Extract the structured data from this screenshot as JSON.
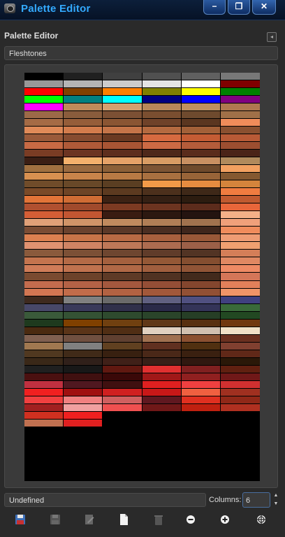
{
  "window": {
    "title": "Palette Editor",
    "minimize_glyph": "−",
    "restore_glyph": "❐",
    "close_glyph": "✕"
  },
  "panel": {
    "title": "Palette Editor",
    "collapse_glyph": "◂"
  },
  "palette_selector": {
    "value": "Fleshtones"
  },
  "swatches": [
    "#000000",
    "#202020",
    "#404040",
    "#505050",
    "#606060",
    "#787878",
    "#989898",
    "#b4b4b4",
    "#cccccc",
    "#e4e4e4",
    "#ffffff",
    "#800000",
    "#ff0000",
    "#804000",
    "#ff8000",
    "#808000",
    "#ffff00",
    "#008000",
    "#00ff00",
    "#008080",
    "#00ffff",
    "#000080",
    "#0000ff",
    "#800080",
    "#ff00ff",
    "#c08a5a",
    "#d4a070",
    "#b8875a",
    "#c09060",
    "#b07850",
    "#9c6a48",
    "#8a5c3c",
    "#7c5034",
    "#7a4e30",
    "#6e4a2e",
    "#a07048",
    "#a56b45",
    "#955d39",
    "#8a5533",
    "#6f4229",
    "#5a3620",
    "#f08c5a",
    "#e08a58",
    "#d27c4c",
    "#c47448",
    "#b46a40",
    "#a26038",
    "#8a5030",
    "#9a5a3a",
    "#864c30",
    "#6a3a22",
    "#d66a40",
    "#c45c34",
    "#b85a36",
    "#c86a44",
    "#b05a38",
    "#a85534",
    "#cc6a44",
    "#b45c3a",
    "#9c4e30",
    "#7a3c24",
    "#6c3422",
    "#5e2e1e",
    "#4e281a",
    "#5a2c1c",
    "#4a2418",
    "#3a1e14",
    "#f4b06c",
    "#e6a268",
    "#d89c64",
    "#c89062",
    "#b08a5c",
    "#a07040",
    "#9a6a40",
    "#8c6038",
    "#7c5434",
    "#6e4a2c",
    "#f2a060",
    "#d89050",
    "#c8844a",
    "#b87a44",
    "#a87040",
    "#986438",
    "#845830",
    "#704c2a",
    "#684828",
    "#5a3e22",
    "#f29a48",
    "#e68c40",
    "#d4843c",
    "#7a4a28",
    "#6e4426",
    "#5c3a20",
    "#4c301c",
    "#3e2818",
    "#f07c40",
    "#e27438",
    "#d06c34",
    "#3c2214",
    "#342014",
    "#2c1c10",
    "#c05a30",
    "#b05030",
    "#a04a2c",
    "#7c3a22",
    "#6c3420",
    "#5c2c1c",
    "#e8663a",
    "#d45e36",
    "#c25632",
    "#3a1c12",
    "#2c1810",
    "#241410",
    "#f4b088",
    "#e0a078",
    "#d09468",
    "#c08a5e",
    "#b07e56",
    "#a0724e",
    "#f0a07a",
    "#7a4c34",
    "#6a422e",
    "#5a3828",
    "#4a2e22",
    "#3e261c",
    "#f08c5c",
    "#dc8050",
    "#c87448",
    "#b86a44",
    "#a8603e",
    "#985838",
    "#ee9c74",
    "#e09270",
    "#cf8464",
    "#be7858",
    "#ad6c50",
    "#9c6048",
    "#f0a070",
    "#8a5a3c",
    "#7c5036",
    "#6e4630",
    "#603c2a",
    "#523424",
    "#d47e58",
    "#c4744e",
    "#b46a46",
    "#a4603e",
    "#945836",
    "#844e30",
    "#e08862",
    "#d07c58",
    "#c0724e",
    "#b06846",
    "#a05e3e",
    "#905436",
    "#ee8a64",
    "#7a4a30",
    "#6c422a",
    "#5e3a26",
    "#503222",
    "#422a1c",
    "#d47658",
    "#c46c4e",
    "#b46246",
    "#a4583e",
    "#944e36",
    "#84462e",
    "#e2805a",
    "#d27652",
    "#c26c4a",
    "#b26242",
    "#a2583a",
    "#925034",
    "#f09468",
    "#3e2a1e",
    "#808080",
    "#6a6a6a",
    "#606080",
    "#505080",
    "#404080",
    "#484868",
    "#3a3a5a",
    "#30304a",
    "#2a2a48",
    "#343458",
    "#3a6a3a",
    "#3a5a3a",
    "#345234",
    "#2e4a2e",
    "#2a442a",
    "#263e26",
    "#224822",
    "#1e3a1e",
    "#804000",
    "#704010",
    "#603818",
    "#583010",
    "#703810",
    "#4a2a10",
    "#5a3418",
    "#502e14",
    "#e0d0c0",
    "#d0c0b0",
    "#f0e0c8",
    "#806050",
    "#705040",
    "#604030",
    "#a07050",
    "#8a5030",
    "#6a3020",
    "#a07850",
    "#808080",
    "#604020",
    "#603020",
    "#503010",
    "#804030",
    "#503820",
    "#402a18",
    "#382010",
    "#4a2818",
    "#3a2010",
    "#602818",
    "#3a2818",
    "#30201a",
    "#402018",
    "#382018",
    "#301810",
    "#2a1808",
    "#202020",
    "#181818",
    "#601810",
    "#e03030",
    "#802020",
    "#602010",
    "#4a1010",
    "#401010",
    "#3a0808",
    "#a01818",
    "#902020",
    "#701818",
    "#c03040",
    "#501820",
    "#401010",
    "#e02020",
    "#f04040",
    "#d03030",
    "#f02020",
    "#a01010",
    "#d02020",
    "#c81818",
    "#f06040",
    "#a03020",
    "#f04040",
    "#f08080",
    "#d06060",
    "#601820",
    "#e03020",
    "#902818",
    "#a02020",
    "#f0a0a0",
    "#f05050",
    "#701818",
    "#c02010",
    "#b03020",
    "#d03020",
    "#f02020",
    "#000000",
    "#000000",
    "#000000",
    "#000000",
    "#c07050",
    "#e02020",
    "#000000",
    "#000000",
    "#000000",
    "#000000"
  ],
  "name_field": {
    "value": "Undefined"
  },
  "columns": {
    "label": "Columns:",
    "value": "6",
    "up_glyph": "▲",
    "down_glyph": "▼"
  },
  "toolbar_icons": [
    "save-icon",
    "save-as-icon",
    "edit-icon",
    "new-document-icon",
    "delete-icon",
    "remove-color-icon",
    "add-color-icon",
    "color-picker-icon"
  ],
  "colors": {
    "title_accent": "#33aaff",
    "panel_bg": "#2a2a2a"
  }
}
